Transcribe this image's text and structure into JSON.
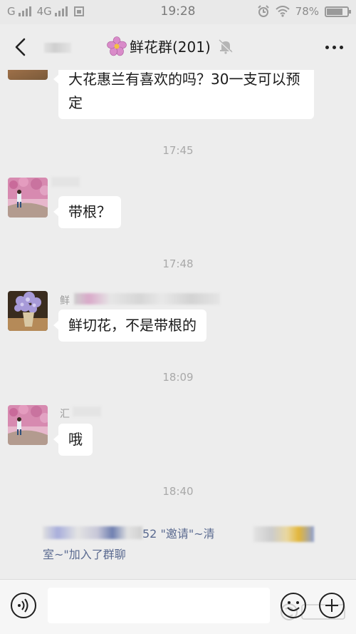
{
  "status_bar": {
    "carrier1": "G",
    "carrier2": "4G",
    "time": "19:28",
    "battery": "78%",
    "battery_level": 0.78
  },
  "nav": {
    "title": "鲜花群(201)",
    "icons": [
      "back-arrow-icon",
      "flower-icon",
      "bell-off-icon",
      "more-icon"
    ]
  },
  "messages": {
    "m1_text": "大花惠兰有喜欢的吗？30一支可以预定",
    "t1": "17:45",
    "m2_text": "带根？",
    "t2": "17:48",
    "m3_sender": "鲜",
    "m3_text": "鲜切花，不是带根的",
    "t3": "18:09",
    "m4_sender": "汇",
    "m4_text": "哦",
    "t4": "18:40",
    "system_line1_a": "52",
    "system_line1_b": "\"邀请\"~清",
    "system_line2": "室~\"加入了群聊"
  },
  "input_bar": {
    "icons": [
      "voice-icon",
      "emoji-icon",
      "plus-icon"
    ]
  },
  "colors": {
    "background": "#ededed",
    "bubble": "#ffffff",
    "system_text": "#5a6a90",
    "timestamp": "#a9a9a9"
  }
}
